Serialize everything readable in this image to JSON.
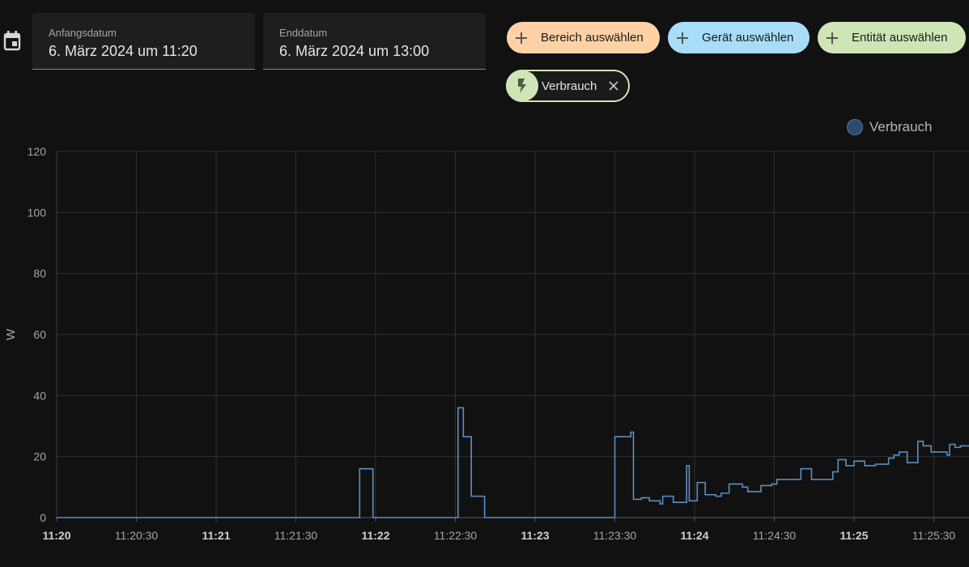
{
  "date_range": {
    "start": {
      "label": "Anfangsdatum",
      "value": "6. März 2024 um 11:20"
    },
    "end": {
      "label": "Enddatum",
      "value": "6. März 2024 um 13:00"
    }
  },
  "target_pickers": {
    "area": "Bereich auswählen",
    "device": "Gerät auswählen",
    "entity": "Entität auswählen"
  },
  "selected_entity": {
    "name": "Verbrauch",
    "icon": "flash-icon"
  },
  "colors": {
    "area_chip": "#ffd2a5",
    "device_chip": "#a7ddf7",
    "entity_chip": "#cfe5b6",
    "series_line": "#5b8ec4",
    "legend_dot": "#2e4a6b"
  },
  "chart_data": {
    "type": "line",
    "step": true,
    "legend": {
      "position": "top-right",
      "entries": [
        "Verbrauch"
      ]
    },
    "ylabel": "W",
    "ylim": [
      0,
      120
    ],
    "yticks": [
      "0",
      "20",
      "40",
      "60",
      "80",
      "100",
      "120"
    ],
    "xlim": [
      "11:20:00",
      "11:25:40"
    ],
    "xticks": [
      {
        "label": "11:20",
        "bold": true
      },
      {
        "label": "11:20:30",
        "bold": false
      },
      {
        "label": "11:21",
        "bold": true
      },
      {
        "label": "11:21:30",
        "bold": false
      },
      {
        "label": "11:22",
        "bold": true
      },
      {
        "label": "11:22:30",
        "bold": false
      },
      {
        "label": "11:23",
        "bold": true
      },
      {
        "label": "11:23:30",
        "bold": false
      },
      {
        "label": "11:24",
        "bold": true
      },
      {
        "label": "11:24:30",
        "bold": false
      },
      {
        "label": "11:25",
        "bold": true
      },
      {
        "label": "11:25:30",
        "bold": false
      }
    ],
    "grid": true,
    "series": [
      {
        "name": "Verbrauch",
        "points": [
          [
            "11:20:00",
            0
          ],
          [
            "11:21:54",
            16
          ],
          [
            "11:21:59",
            0
          ],
          [
            "11:22:31",
            36
          ],
          [
            "11:22:33",
            26.5
          ],
          [
            "11:22:36",
            7
          ],
          [
            "11:22:41",
            0
          ],
          [
            "11:23:30",
            26.5
          ],
          [
            "11:23:36",
            28
          ],
          [
            "11:23:37",
            6
          ],
          [
            "11:23:40",
            6.5
          ],
          [
            "11:23:43",
            5.5
          ],
          [
            "11:23:47",
            4.5
          ],
          [
            "11:23:48",
            7
          ],
          [
            "11:23:52",
            5
          ],
          [
            "11:23:57",
            17
          ],
          [
            "11:23:58",
            5.5
          ],
          [
            "11:24:01",
            11.5
          ],
          [
            "11:24:04",
            7.5
          ],
          [
            "11:24:08",
            7
          ],
          [
            "11:24:10",
            8
          ],
          [
            "11:24:13",
            11
          ],
          [
            "11:24:18",
            10
          ],
          [
            "11:24:20",
            8.5
          ],
          [
            "11:24:25",
            10.5
          ],
          [
            "11:24:29",
            11
          ],
          [
            "11:24:31",
            12.5
          ],
          [
            "11:24:40",
            16
          ],
          [
            "11:24:44",
            12.5
          ],
          [
            "11:24:52",
            15
          ],
          [
            "11:24:54",
            19
          ],
          [
            "11:24:57",
            17
          ],
          [
            "11:25:00",
            18.5
          ],
          [
            "11:25:04",
            17
          ],
          [
            "11:25:08",
            17.5
          ],
          [
            "11:25:13",
            19.5
          ],
          [
            "11:25:15",
            20.5
          ],
          [
            "11:25:17",
            21.5
          ],
          [
            "11:25:20",
            18
          ],
          [
            "11:25:24",
            25
          ],
          [
            "11:25:26",
            23.5
          ],
          [
            "11:25:29",
            21.5
          ],
          [
            "11:25:35",
            20.5
          ],
          [
            "11:25:36",
            24
          ],
          [
            "11:25:38",
            23
          ],
          [
            "11:25:40",
            23.5
          ]
        ]
      }
    ]
  }
}
